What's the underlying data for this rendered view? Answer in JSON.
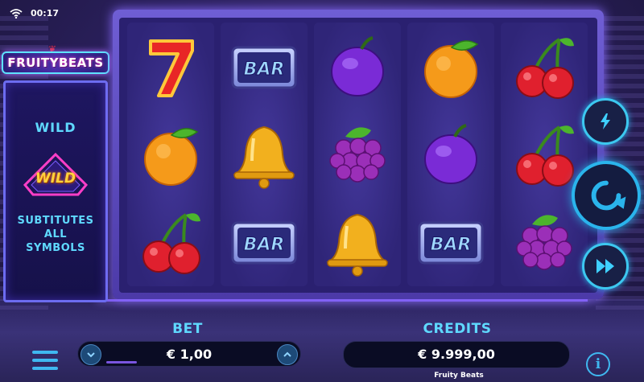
{
  "status": {
    "time": "00:17"
  },
  "logo": {
    "text": "FRUITYBEATS"
  },
  "info_panel": {
    "title": "WILD",
    "badge_text": "WILD",
    "lines": [
      "SUBTITUTES",
      "ALL",
      "SYMBOLS"
    ]
  },
  "reels": [
    [
      "seven",
      "orange",
      "cherry"
    ],
    [
      "bar",
      "bell",
      "bar"
    ],
    [
      "plum",
      "grapes",
      "bell"
    ],
    [
      "orange",
      "plum",
      "bar"
    ],
    [
      "cherry",
      "cherry",
      "grapes"
    ]
  ],
  "symbol_labels": {
    "bar": "BAR"
  },
  "controls": {
    "turbo_icon": "lightning-icon",
    "spin_icon": "refresh-arrow-icon",
    "autoplay_icon": "fast-forward-icon",
    "bet_down_icon": "chevron-down-icon",
    "bet_up_icon": "chevron-up-icon",
    "menu_icon": "hamburger-menu-icon",
    "info_icon": "info-icon"
  },
  "bet": {
    "label": "BET",
    "value": "€ 1,00"
  },
  "credits": {
    "label": "CREDITS",
    "value": "€ 9.999,00"
  },
  "game_name": "Fruity Beats",
  "info_button_glyph": "i",
  "colors": {
    "accent": "#5fd9ff",
    "frame": "#6f5ed4",
    "background": "#2c2160"
  }
}
